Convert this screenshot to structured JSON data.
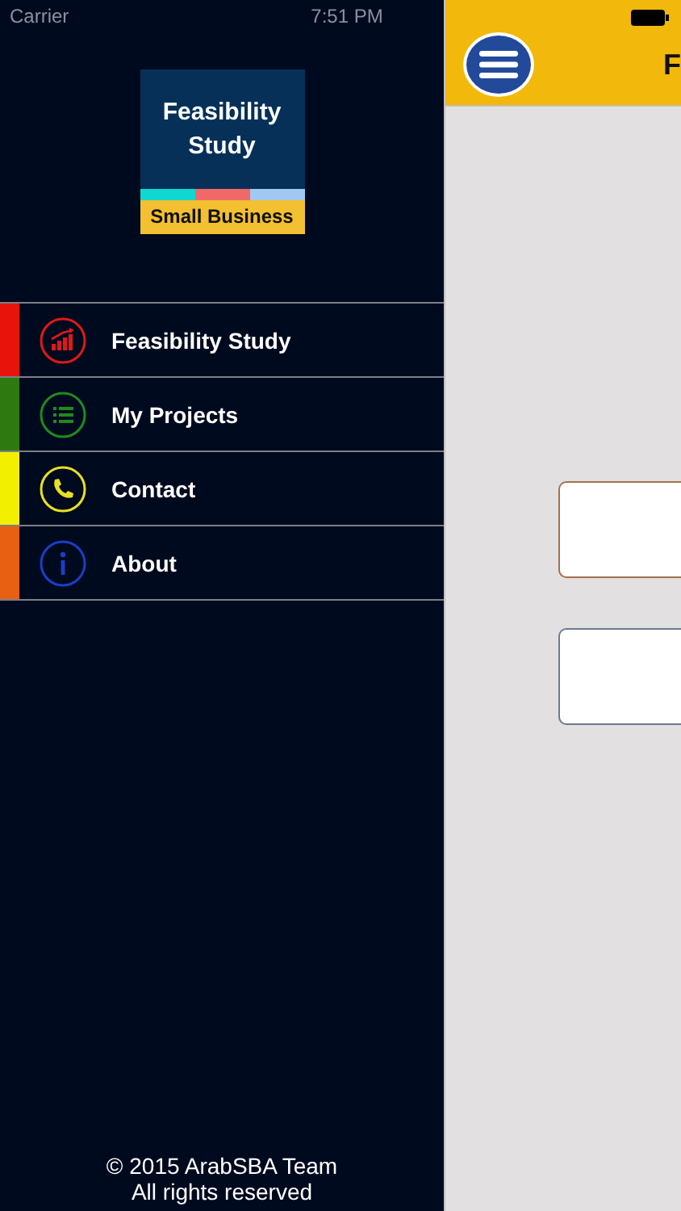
{
  "status_bar": {
    "carrier": "Carrier",
    "time": "7:51 PM"
  },
  "sidebar": {
    "logo": {
      "title": "Feasibility Study",
      "subtitle": "Small Business"
    },
    "items": [
      {
        "label": "Feasibility Study",
        "kind": "chart",
        "color": "#e8140c"
      },
      {
        "label": "My Projects",
        "kind": "list",
        "color": "#2f7a10"
      },
      {
        "label": "Contact",
        "kind": "phone",
        "color": "#f2f000"
      },
      {
        "label": "About",
        "kind": "info",
        "color": "#e86012"
      }
    ],
    "footer": [
      "© 2015 ArabSBA Team",
      "All rights reserved"
    ]
  },
  "header": {
    "title": "F"
  }
}
